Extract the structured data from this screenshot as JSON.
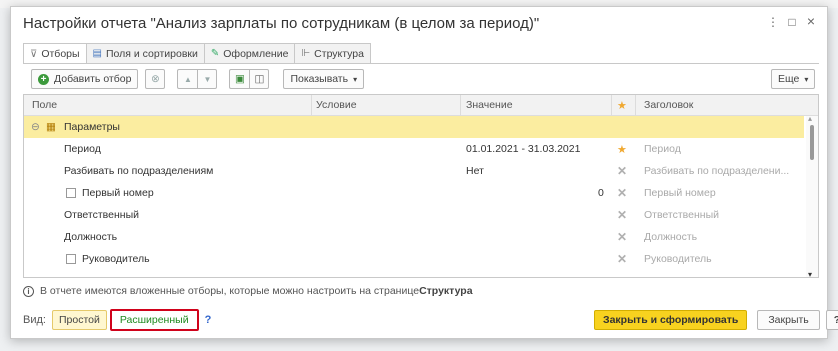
{
  "window": {
    "title": "Настройки отчета \"Анализ зарплаты по сотрудникам (в целом за период)\"",
    "controls": {
      "more": "⋮",
      "maximize": "□",
      "close": "×"
    }
  },
  "tabs": [
    {
      "label": "Отборы",
      "icon": "filter-icon",
      "glyph": "⊽"
    },
    {
      "label": "Поля и сортировки",
      "icon": "fields-icon",
      "glyph": "▤"
    },
    {
      "label": "Оформление",
      "icon": "brush-icon",
      "glyph": "✎"
    },
    {
      "label": "Структура",
      "icon": "structure-icon",
      "glyph": "⊩"
    }
  ],
  "toolbar": {
    "add_filter": "Добавить отбор",
    "show": "Показывать",
    "more": "Еще",
    "dropdown": "▾",
    "icons": {
      "delete": "⊗",
      "up": "▲",
      "down": "▼",
      "group": "▣",
      "ungroup": "◫"
    }
  },
  "grid": {
    "columns": {
      "field": "Поле",
      "condition": "Условие",
      "value": "Значение",
      "star": "★",
      "title": "Заголовок"
    },
    "group": {
      "label": "Параметры",
      "collapse": "⊖",
      "icon": "▦"
    },
    "rows": [
      {
        "field": "Период",
        "value": "01.01.2021 - 31.03.2021",
        "mark": "★",
        "title": "Период",
        "checkbox": false
      },
      {
        "field": "Разбивать по подразделениям",
        "value": "Нет",
        "mark": "✕",
        "title": "Разбивать по подразделени...",
        "checkbox": false
      },
      {
        "field": "Первый номер",
        "value": "0",
        "mark": "✕",
        "title": "Первый номер",
        "checkbox": true
      },
      {
        "field": "Ответственный",
        "value": "",
        "mark": "✕",
        "title": "Ответственный",
        "checkbox": false
      },
      {
        "field": "Должность",
        "value": "",
        "mark": "✕",
        "title": "Должность",
        "checkbox": false
      },
      {
        "field": "Руководитель",
        "value": "",
        "mark": "✕",
        "title": "Руководитель",
        "checkbox": true
      }
    ],
    "scroll_up": "▴",
    "scroll_down": "▾"
  },
  "info": {
    "icon": "i",
    "text": "В отчете имеются вложенные отборы, которые можно настроить на странице ",
    "link": "Структура"
  },
  "footer": {
    "view_label": "Вид:",
    "simple": "Простой",
    "advanced": "Расширенный",
    "help_q": "?",
    "close_and_generate": "Закрыть и сформировать",
    "close": "Закрыть",
    "help": "?"
  },
  "colors": {
    "selected_row": "#fbeda0",
    "primary_button": "#f8d21f",
    "highlight_border": "#d0021b",
    "advanced_text": "#1f8a1f",
    "star": "#f0a830"
  }
}
